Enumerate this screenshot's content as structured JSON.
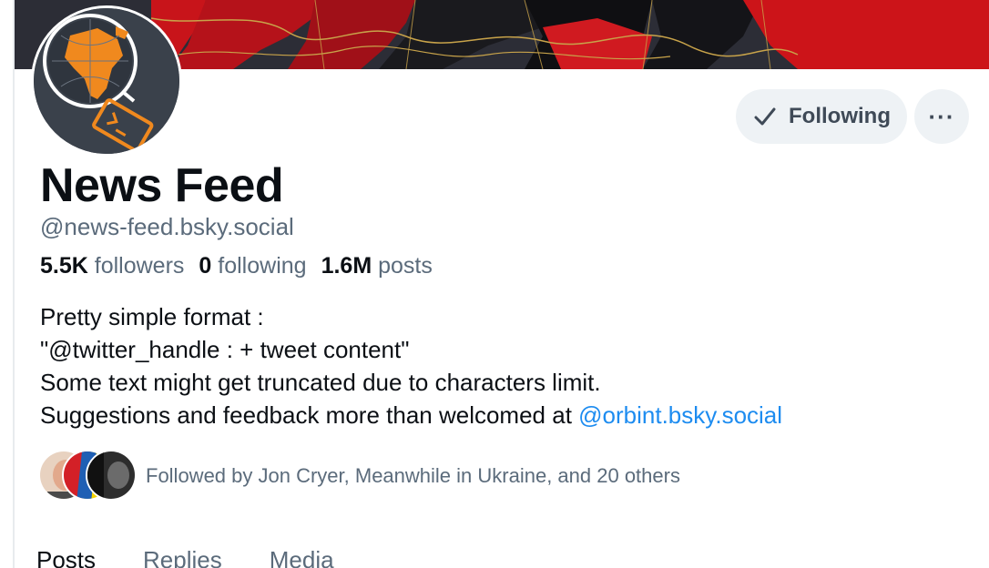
{
  "profile": {
    "display_name": "News Feed",
    "handle": "@news-feed.bsky.social",
    "stats": {
      "followers_count": "5.5K",
      "followers_label": "followers",
      "following_count": "0",
      "following_label": "following",
      "posts_count": "1.6M",
      "posts_label": "posts"
    },
    "bio": {
      "line1": "Pretty simple format :",
      "line2": "\"@twitter_handle : + tweet content\"",
      "line3": "Some text might get truncated due to characters limit.",
      "line4_prefix": "Suggestions and feedback more than welcomed at ",
      "line4_link": "@orbint.bsky.social"
    },
    "followed_by_text": "Followed by Jon Cryer, Meanwhile in Ukraine, and 20 others"
  },
  "actions": {
    "following_label": "Following",
    "more_label": "···"
  },
  "tabs": [
    {
      "label": "Posts"
    },
    {
      "label": "Replies"
    },
    {
      "label": "Media"
    }
  ],
  "colors": {
    "link": "#1d8cf0",
    "muted_text": "#5b6b7b",
    "button_bg": "#eef2f5",
    "banner_red": "#c8141a",
    "avatar_orange": "#f0891e"
  },
  "icons": [
    "check-icon",
    "more-icon",
    "globe-logo",
    "terminal-icon"
  ]
}
